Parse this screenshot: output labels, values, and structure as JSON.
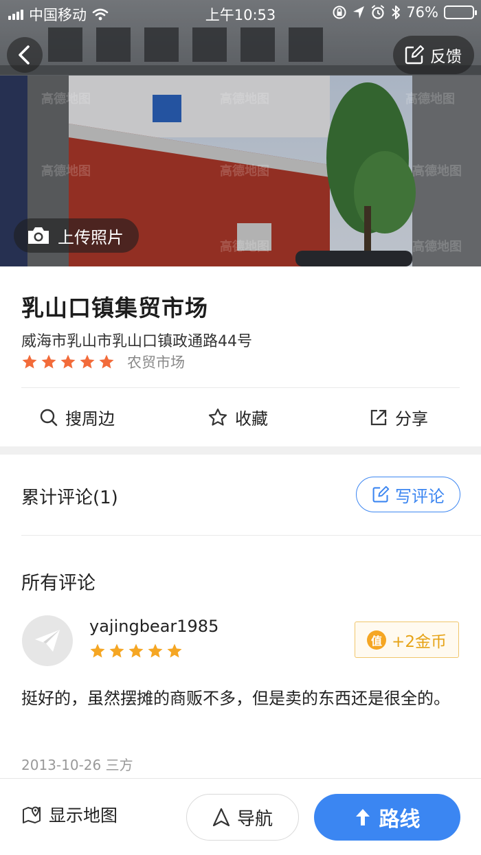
{
  "status_bar": {
    "carrier": "中国移动",
    "time": "上午10:53",
    "battery_percent": "76%",
    "battery_level": 0.76,
    "icons": [
      "signal-icon",
      "wifi-icon",
      "lock-rotation-icon",
      "location-arrow-icon",
      "alarm-icon",
      "bluetooth-icon",
      "battery-icon"
    ]
  },
  "hero": {
    "feedback_label": "反馈",
    "upload_label": "上传照片"
  },
  "poi": {
    "name": "乳山口镇集贸市场",
    "address": "威海市乳山市乳山口镇政通路44号",
    "rating": 5,
    "category": "农贸市场"
  },
  "actions": {
    "search_nearby": "搜周边",
    "favorite": "收藏",
    "share": "分享"
  },
  "reviews": {
    "count_label": "累计评论(1)",
    "write_label": "写评论",
    "section_title": "所有评论",
    "items": [
      {
        "username": "yajingbear1985",
        "rating": 5,
        "coin_badge_icon_text": "值",
        "coin_reward": "+2金币",
        "text": "挺好的，虽然摆摊的商贩不多，但是卖的东西还是很全的。",
        "date_source": "2013-10-26 三方"
      }
    ]
  },
  "bottom_bar": {
    "show_map": "显示地图",
    "navigate": "导航",
    "route": "路线"
  },
  "colors": {
    "primary_blue": "#3b86f2",
    "star_orange": "#f26b3a",
    "star_yellow": "#f5a623",
    "coin_gold": "#e6a317"
  }
}
